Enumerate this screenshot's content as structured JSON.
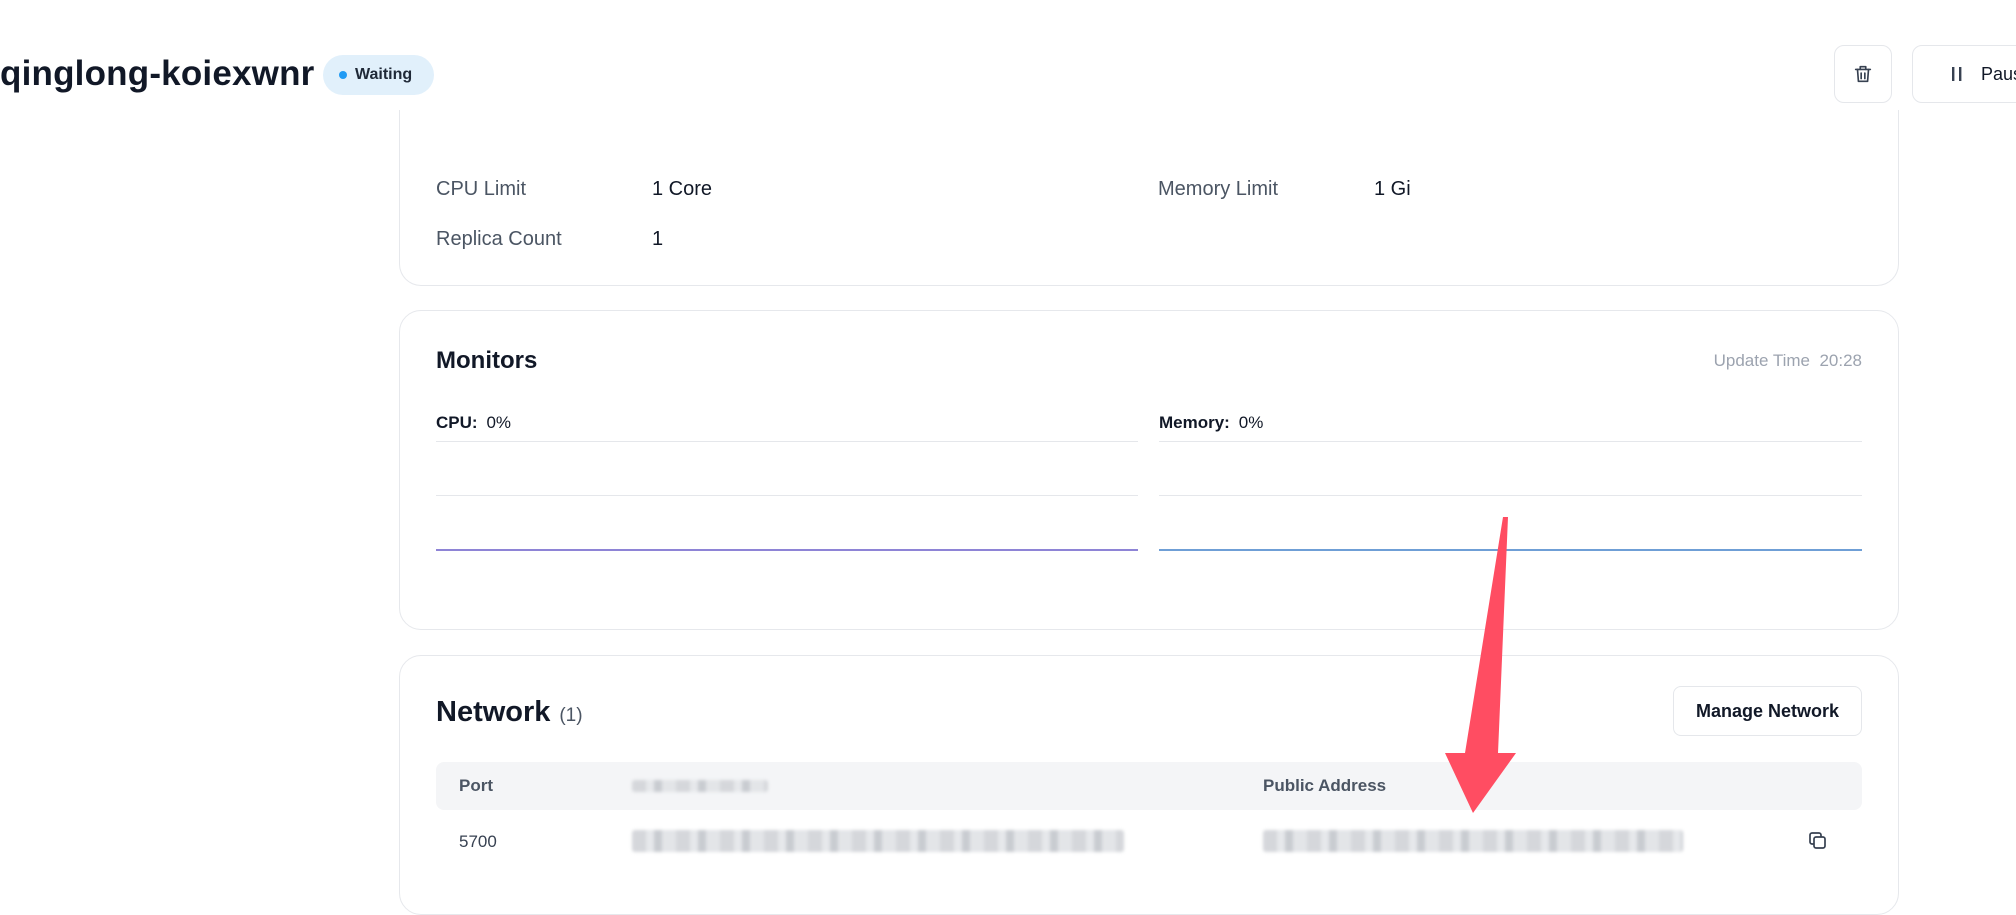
{
  "header": {
    "app_name": "qinglong-koiexwnr",
    "status": "Waiting",
    "pause_label": "Paus"
  },
  "spec": {
    "cpu_limit_label": "CPU Limit",
    "cpu_limit_value": "1 Core",
    "memory_limit_label": "Memory Limit",
    "memory_limit_value": "1 Gi",
    "replica_label": "Replica Count",
    "replica_value": "1"
  },
  "monitors": {
    "title": "Monitors",
    "update_time_label": "Update Time",
    "update_time_value": "20:28",
    "cpu_label": "CPU:",
    "cpu_value": "0%",
    "memory_label": "Memory:",
    "memory_value": "0%"
  },
  "network": {
    "title": "Network",
    "count": "(1)",
    "manage_label": "Manage Network",
    "columns": {
      "port": "Port",
      "public_address": "Public Address"
    },
    "rows": [
      {
        "port": "5700"
      }
    ]
  },
  "colors": {
    "accent": "#219bf4",
    "status_badge_bg": "#e1f0fb",
    "arrow": "#ff4d62",
    "cpu_line": "#8e84d6",
    "memory_line": "#6f9fd6"
  }
}
